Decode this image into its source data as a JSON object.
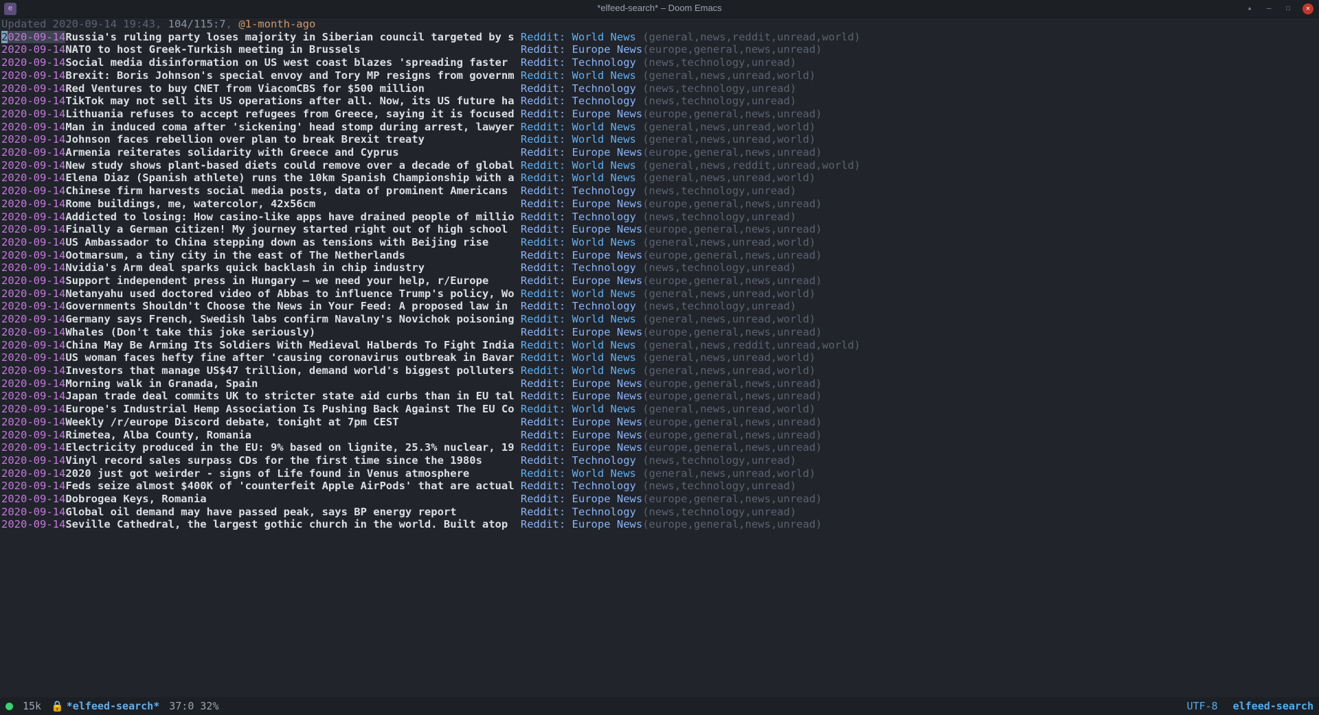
{
  "window": {
    "title": "*elfeed-search* – Doom Emacs"
  },
  "status": {
    "updated_label": "Updated ",
    "updated_value": "2020-09-14 19:43",
    "sep1": ", ",
    "count": "104/115:7",
    "sep2": ", ",
    "filter": "@1-month-ago"
  },
  "feeds": {
    "world": "Reddit: World News",
    "europe": "Reddit: Europe News",
    "tech": "Reddit: Technology"
  },
  "tag_strings": {
    "world": "(general,news,reddit,unread,world)",
    "world2": "(general,news,unread,world)",
    "europe": "(europe,general,news,unread)",
    "tech": "(news,technology,unread)"
  },
  "entries": [
    {
      "date": "2020-09-14",
      "title": "Russia's ruling party loses majority in Siberian council targeted by s",
      "feed": "world",
      "tags": "world",
      "sel": true
    },
    {
      "date": "2020-09-14",
      "title": "NATO to host Greek-Turkish meeting in Brussels",
      "feed": "europe",
      "tags": "europe"
    },
    {
      "date": "2020-09-14",
      "title": "Social media disinformation on US west coast blazes 'spreading faster",
      "feed": "tech",
      "tags": "tech"
    },
    {
      "date": "2020-09-14",
      "title": "Brexit: Boris Johnson's special envoy and Tory MP resigns from governm",
      "feed": "world",
      "tags": "world2"
    },
    {
      "date": "2020-09-14",
      "title": "Red Ventures to buy CNET from ViacomCBS for $500 million",
      "feed": "tech",
      "tags": "tech"
    },
    {
      "date": "2020-09-14",
      "title": "TikTok may not sell its US operations after all. Now, its US future ha",
      "feed": "tech",
      "tags": "tech"
    },
    {
      "date": "2020-09-14",
      "title": "Lithuania refuses to accept refugees from Greece, saying it is focused",
      "feed": "europe",
      "tags": "europe"
    },
    {
      "date": "2020-09-14",
      "title": "Man in induced coma after 'sickening' head stomp during arrest, lawyer",
      "feed": "world",
      "tags": "world2"
    },
    {
      "date": "2020-09-14",
      "title": "Johnson faces rebellion over plan to break Brexit treaty",
      "feed": "world",
      "tags": "world2"
    },
    {
      "date": "2020-09-14",
      "title": "Armenia reiterates solidarity with Greece and Cyprus",
      "feed": "europe",
      "tags": "europe"
    },
    {
      "date": "2020-09-14",
      "title": "New study shows plant-based diets could remove over a decade of global",
      "feed": "world",
      "tags": "world"
    },
    {
      "date": "2020-09-14",
      "title": "Elena Diaz (Spanish athlete) runs the 10km Spanish Championship with a",
      "feed": "world",
      "tags": "world2"
    },
    {
      "date": "2020-09-14",
      "title": "Chinese firm harvests social media posts, data of prominent Americans",
      "feed": "tech",
      "tags": "tech"
    },
    {
      "date": "2020-09-14",
      "title": "Rome buildings, me, watercolor, 42x56cm",
      "feed": "europe",
      "tags": "europe"
    },
    {
      "date": "2020-09-14",
      "title": "Addicted to losing: How casino-like apps have drained people of millio",
      "feed": "tech",
      "tags": "tech"
    },
    {
      "date": "2020-09-14",
      "title": "Finally a German citizen! My journey started right out of high school",
      "feed": "europe",
      "tags": "europe"
    },
    {
      "date": "2020-09-14",
      "title": "US Ambassador to China stepping down as tensions with Beijing rise",
      "feed": "world",
      "tags": "world2"
    },
    {
      "date": "2020-09-14",
      "title": "Ootmarsum, a tiny city in the east of The Netherlands",
      "feed": "europe",
      "tags": "europe"
    },
    {
      "date": "2020-09-14",
      "title": "Nvidia's Arm deal sparks quick backlash in chip industry",
      "feed": "tech",
      "tags": "tech"
    },
    {
      "date": "2020-09-14",
      "title": "Support independent press in Hungary – we need your help, r/Europe",
      "feed": "europe",
      "tags": "europe"
    },
    {
      "date": "2020-09-14",
      "title": "Netanyahu used doctored video of Abbas to influence Trump's policy, Wo",
      "feed": "world",
      "tags": "world2"
    },
    {
      "date": "2020-09-14",
      "title": "Governments Shouldn't Choose the News in Your Feed: A proposed law in",
      "feed": "tech",
      "tags": "tech"
    },
    {
      "date": "2020-09-14",
      "title": "Germany says French, Swedish labs confirm Navalny's Novichok poisoning",
      "feed": "world",
      "tags": "world2"
    },
    {
      "date": "2020-09-14",
      "title": "Whales (Don't take this joke seriously)",
      "feed": "europe",
      "tags": "europe"
    },
    {
      "date": "2020-09-14",
      "title": "China May Be Arming Its Soldiers With Medieval Halberds To Fight India",
      "feed": "world",
      "tags": "world"
    },
    {
      "date": "2020-09-14",
      "title": "US woman faces hefty fine after 'causing coronavirus outbreak in Bavar",
      "feed": "world",
      "tags": "world2"
    },
    {
      "date": "2020-09-14",
      "title": "Investors that manage US$47 trillion, demand world's biggest polluters",
      "feed": "world",
      "tags": "world2"
    },
    {
      "date": "2020-09-14",
      "title": "Morning walk in Granada, Spain",
      "feed": "europe",
      "tags": "europe"
    },
    {
      "date": "2020-09-14",
      "title": "Japan trade deal commits UK to stricter state aid curbs than in EU tal",
      "feed": "europe",
      "tags": "europe"
    },
    {
      "date": "2020-09-14",
      "title": "Europe's Industrial Hemp Association Is Pushing Back Against The EU Co",
      "feed": "world",
      "tags": "world2"
    },
    {
      "date": "2020-09-14",
      "title": "Weekly /r/europe Discord debate, tonight at 7pm CEST",
      "feed": "europe",
      "tags": "europe"
    },
    {
      "date": "2020-09-14",
      "title": "Rimetea, Alba County, Romania",
      "feed": "europe",
      "tags": "europe"
    },
    {
      "date": "2020-09-14",
      "title": "Electricity produced in the EU: 9% based on lignite, 25.3% nuclear, 19",
      "feed": "europe",
      "tags": "europe"
    },
    {
      "date": "2020-09-14",
      "title": "Vinyl record sales surpass CDs for the first time since the 1980s",
      "feed": "tech",
      "tags": "tech"
    },
    {
      "date": "2020-09-14",
      "title": "2020 just got weirder - signs of Life found in Venus atmosphere",
      "feed": "world",
      "tags": "world2"
    },
    {
      "date": "2020-09-14",
      "title": "Feds seize almost $400K of 'counterfeit Apple AirPods' that are actual",
      "feed": "tech",
      "tags": "tech"
    },
    {
      "date": "2020-09-14",
      "title": "Dobrogea Keys, Romania",
      "feed": "europe",
      "tags": "europe"
    },
    {
      "date": "2020-09-14",
      "title": "Global oil demand may have passed peak, says BP energy report",
      "feed": "tech",
      "tags": "tech"
    },
    {
      "date": "2020-09-14",
      "title": "Seville Cathedral, the largest gothic church in the world. Built atop",
      "feed": "europe",
      "tags": "europe"
    }
  ],
  "modeline": {
    "size": "15k",
    "buffer": "*elfeed-search*",
    "position": "37:0 32%",
    "encoding": "UTF-8",
    "mode": "elfeed-search"
  }
}
